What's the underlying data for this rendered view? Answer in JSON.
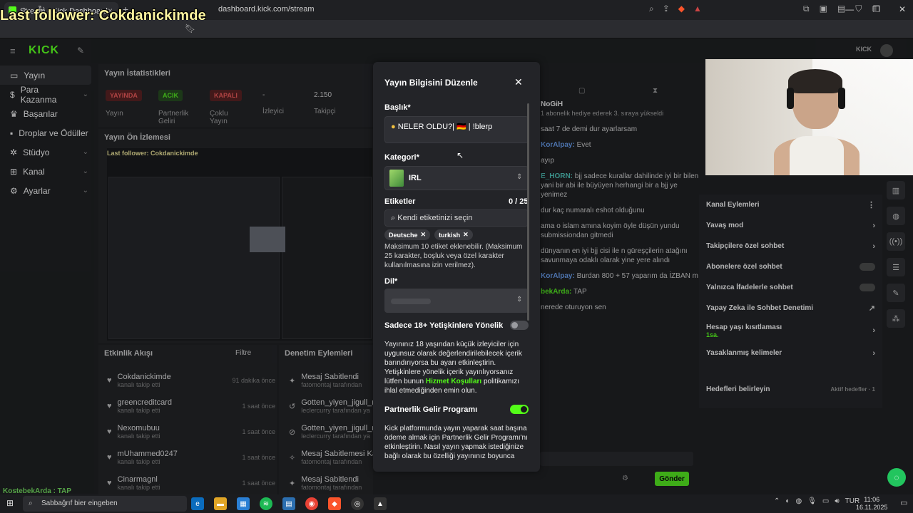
{
  "overlay": {
    "last_follower": "Last follower: Cokdanickimde",
    "bottom_name": "KostebekArda : TAP"
  },
  "browser": {
    "tab_title": "Stream - Kick Dashboard",
    "url": "dashboard.kick.com/stream"
  },
  "sidebar": {
    "items": [
      {
        "label": "Yayın",
        "icon": "video-icon",
        "active": true
      },
      {
        "label": "Para Kazanma",
        "icon": "dollar-icon"
      },
      {
        "label": "Başarılar",
        "icon": "trophy-icon"
      },
      {
        "label": "Droplar ve Ödüller",
        "icon": "gift-icon"
      },
      {
        "label": "Stüdyo",
        "icon": "studio-icon"
      },
      {
        "label": "Kanal",
        "icon": "channel-icon"
      },
      {
        "label": "Ayarlar",
        "icon": "gear-icon"
      }
    ]
  },
  "stats": {
    "title": "Yayın İstatistikleri",
    "items": [
      {
        "badge": "YAYINDA",
        "label": "Yayın",
        "color": "#ff4d4d"
      },
      {
        "badge": "ACIK",
        "label": "Partnerlik Geliri",
        "color": "#53fc18"
      },
      {
        "badge": "KAPALI",
        "label": "Çoklu Yayın",
        "color": "#ff4d4d"
      },
      {
        "value": "-",
        "label": "İzleyici"
      },
      {
        "value": "2.150",
        "label": "Takipçi"
      }
    ]
  },
  "preview": {
    "title": "Yayın Ön İzlemesi",
    "overlay": "Last follower: Cokdanickimde"
  },
  "activity": {
    "title": "Etkinlik Akışı",
    "filter": "Filtre",
    "items": [
      {
        "name": "Cokdanickimde",
        "sub": "kanalı takip etti",
        "time": "91 dakika önce"
      },
      {
        "name": "greencreditcard",
        "sub": "kanalı takip etti",
        "time": "1 saat önce"
      },
      {
        "name": "Nexomubuu",
        "sub": "kanalı takip etti",
        "time": "1 saat önce"
      },
      {
        "name": "mUhammed0247",
        "sub": "kanalı takip etti",
        "time": "1 saat önce"
      },
      {
        "name": "Cinarmagnl",
        "sub": "kanalı takip etti",
        "time": "1 saat önce"
      }
    ]
  },
  "moderation": {
    "title": "Denetim Eylemleri",
    "items": [
      {
        "name": "Mesaj Sabitlendi",
        "sub": "fatomontaj tarafından"
      },
      {
        "name": "Gotten_yiyen_jigull_n",
        "sub": "leclercurry tarafından ya"
      },
      {
        "name": "Gotten_yiyen_jigull_n",
        "sub": "leclercurry tarafından ya"
      },
      {
        "name": "Mesaj Sabitlemesi Ka",
        "sub": "fatomontaj tarafından"
      },
      {
        "name": "Mesaj Sabitlendi",
        "sub": "fatomontaj tarafından"
      }
    ]
  },
  "modal": {
    "title": "Yayın Bilgisini Düzenle",
    "title_label": "Başlık*",
    "title_value": "NELER OLDU?| 🇩🇪 | !blerp",
    "category_label": "Kategori*",
    "category_value": "IRL",
    "tags_label": "Etiketler",
    "tags_count": "0 / 25",
    "tags_placeholder": "Kendi etiketinizi seçin",
    "tags": [
      "Deutsche",
      "turkish"
    ],
    "tags_help": "Maksimum 10 etiket eklenebilir. (Maksimum 25 karakter, boşluk veya özel karakter kullanılmasına izin verilmez).",
    "language_label": "Dil*",
    "adult_label": "Sadece 18+ Yetişkinlere Yönelik",
    "adult_text_1": "Yayınınız 18 yaşından küçük izleyiciler için uygunsuz olarak değerlendirilebilecek içerik barındırıyorsa bu ayarı etkinleştirin. Yetişkinlere yönelik içerik yayınlıyorsanız lütfen bunun",
    "adult_link": "Hizmet Koşulları",
    "adult_text_2": "politikamızı ihlal etmediğinden emin olun.",
    "partner_label": "Partnerlik Gelir Programı",
    "partner_text": "Kick platformunda yayın yaparak saat başına ödeme almak için Partnerlik Gelir Programı'nı etkinleştirin. Nasıl yayın yapmak istediğinize bağlı olarak bu özelliği yayınınız boyunca"
  },
  "chat": {
    "lines": [
      {
        "name": "NoGiH",
        "text": "1 abonelik hediye ederek 3. sıraya yükseldi"
      },
      {
        "name": "",
        "text": "saat 7 de demi dur ayarlarsam"
      },
      {
        "name": "KorAlpay:",
        "text": "Evet"
      },
      {
        "name": "",
        "text": "ayıp"
      },
      {
        "name": "E_HORN:",
        "text": "bjj sadece kurallar dahilinde iyi bir bilen yani bir abi ile büyüyen herhangi bir a bjj ye yenimez"
      },
      {
        "name": "",
        "text": "dur kaç numaralı eshot olduğunu"
      },
      {
        "name": "",
        "text": "ama o islam amına koyim öyle düşün yundu submissiondan gitmedi"
      },
      {
        "name": "",
        "text": "dünyanın en iyi bjj cisi ile n güreşçilerin atağını savunmaya odaklı olarak yine yere alındı"
      },
      {
        "name": "KorAlpay:",
        "text": "Burdan 800 + 57 yaparım da İZBAN m"
      },
      {
        "name": "bekArda:",
        "text": "TAP"
      },
      {
        "name": "",
        "text": "nerede oturuyon sen"
      }
    ],
    "send": "Gönder"
  },
  "channel_actions": {
    "title": "Kanal Eylemleri",
    "items": [
      {
        "label": "Yavaş mod",
        "type": "chevron"
      },
      {
        "label": "Takipçilere özel sohbet",
        "type": "chevron"
      },
      {
        "label": "Abonelere özel sohbet",
        "type": "toggle"
      },
      {
        "label": "Yalnızca İfadelerle sohbet",
        "type": "toggle"
      },
      {
        "label": "Yapay Zeka ile Sohbet Denetimi",
        "type": "link"
      },
      {
        "label": "Hesap yaşı kısıtlaması",
        "sub": "1sa.",
        "type": "chevron"
      },
      {
        "label": "Yasaklanmış kelimeler",
        "type": "chevron"
      },
      {
        "label": "Hedefleri belirleyin",
        "sub": "Aktif hedefler · 1",
        "type": "chevron"
      }
    ]
  },
  "taskbar": {
    "search": "Sabbağrıf bier eingeben",
    "lang": "TUR",
    "time": "11:06",
    "date": "16.11.2025"
  },
  "colors": {
    "accent": "#53fc18",
    "link": "#53fc18"
  }
}
